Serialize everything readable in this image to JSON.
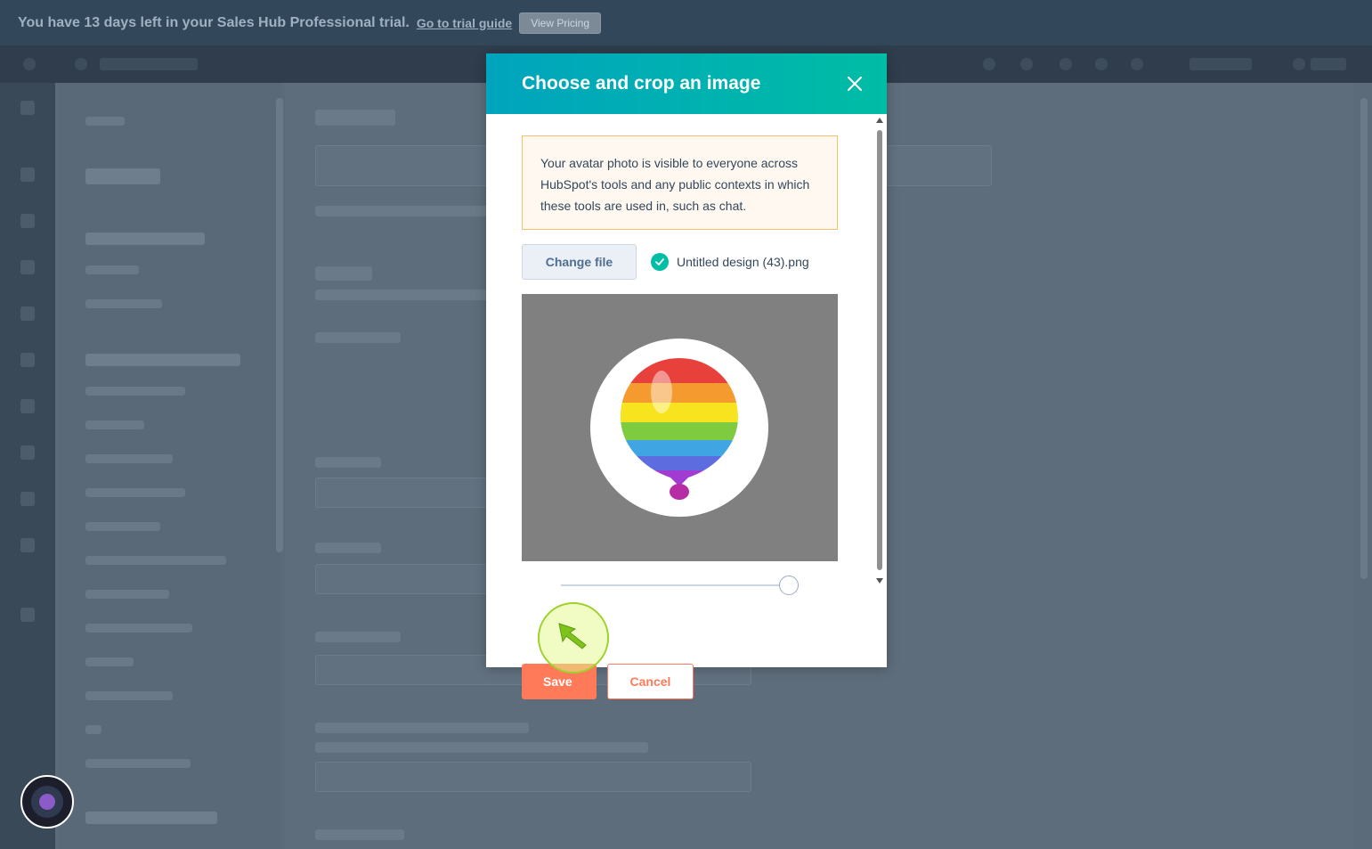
{
  "banner": {
    "text": "You have 13 days left in your Sales Hub Professional trial.",
    "link_label": "Go to trial guide",
    "button_label": "View Pricing"
  },
  "modal": {
    "title": "Choose and crop an image",
    "alert_text": "Your avatar photo is visible to everyone across HubSpot's tools and any public contexts in which these tools are used in, such as chat.",
    "change_file_label": "Change file",
    "file_name": "Untitled design (43).png",
    "zoom_level": 0.95,
    "save_label": "Save",
    "cancel_label": "Cancel"
  },
  "colors": {
    "header_gradient_start": "#00a4bd",
    "header_gradient_end": "#00bda5",
    "primary_button": "#ff7a59",
    "success_check": "#00bda5",
    "alert_border": "#f5c26b",
    "click_indicator": "#9ed12a"
  },
  "icons": {
    "close": "close-icon",
    "success": "check-circle-icon",
    "assistant": "assistant-icon"
  }
}
